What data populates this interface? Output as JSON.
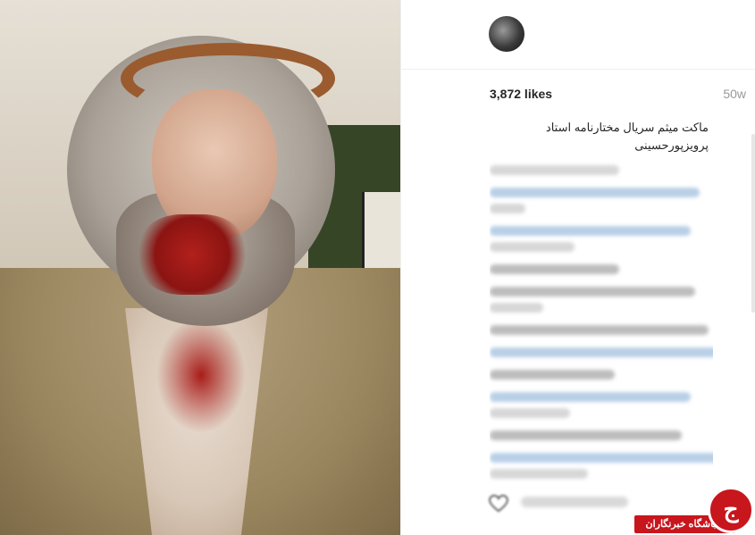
{
  "post": {
    "likes": "3,872 likes",
    "age": "50w",
    "caption_line1": "ماکت میثم سریال مختارنامه استاد",
    "caption_line2": "پرویزپورحسینی"
  },
  "brand": {
    "name": "باشگاه خبرنگاران",
    "glyph": "ج",
    "color": "#c8161d"
  },
  "icons": {
    "like": "heart-icon",
    "avatar": "profile-avatar"
  }
}
